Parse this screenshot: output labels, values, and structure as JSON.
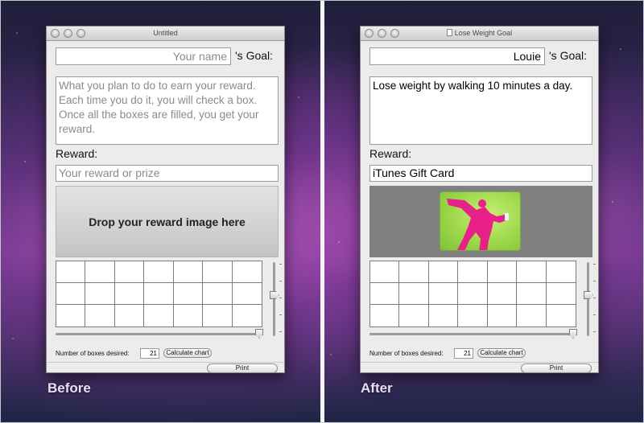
{
  "captions": {
    "left": "Before",
    "right": "After"
  },
  "before": {
    "title": "Untitled",
    "name_placeholder": "Your name",
    "goal_suffix": "'s Goal:",
    "description_placeholder": "What you plan to do to earn your reward.  Each time you do it, you will check a box.  Once all the boxes are filled, you get your reward.",
    "reward_label": "Reward:",
    "reward_placeholder": "Your reward or prize",
    "drop_text": "Drop your reward image here",
    "boxes_label": "Number of boxes desired:",
    "boxes_value": "21",
    "calc_button": "Calculate chart",
    "print_button": "Print"
  },
  "after": {
    "title": "Lose Weight Goal",
    "name_value": "Louie",
    "goal_suffix": "'s Goal:",
    "description_value": "Lose weight by walking 10 minutes a day.",
    "reward_label": "Reward:",
    "reward_value": "iTunes Gift Card",
    "reward_image": "itunes-gift-card-icon",
    "boxes_label": "Number of boxes desired:",
    "boxes_value": "21",
    "calc_button": "Calculate chart",
    "print_button": "Print"
  },
  "chart": {
    "columns": 7,
    "rows": 3
  },
  "colors": {
    "card_green": "#9ed74a",
    "silhouette_pink": "#e8208a"
  }
}
